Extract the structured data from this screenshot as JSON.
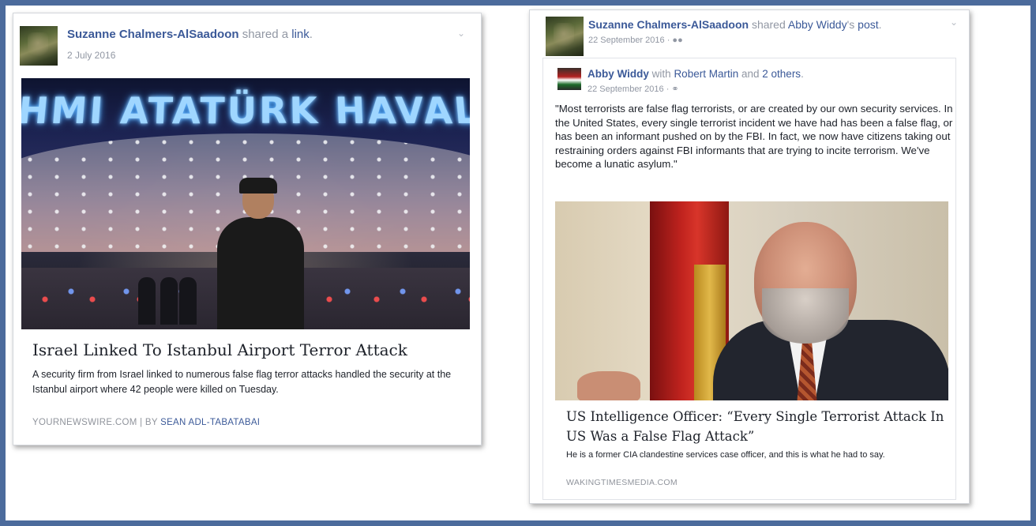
{
  "left_post": {
    "author": "Suzanne Chalmers-AlSaadoon",
    "action": "shared a",
    "object_link": "link",
    "object_suffix": ".",
    "date": "2 July 2016",
    "article": {
      "image_sign": "HMI ATATÜRK HAVALIMAN",
      "headline": "Israel Linked To Istanbul Airport Terror Attack",
      "description": "A security firm from Israel linked to numerous false flag terror attacks handled the security at the Istanbul airport where 42 people were killed on Tuesday.",
      "source": "YOURNEWSWIRE.COM",
      "separator": "|",
      "by_label": "BY",
      "author": "SEAN ADL-TABATABAI"
    }
  },
  "right_post": {
    "author": "Suzanne Chalmers-AlSaadoon",
    "action": "shared",
    "shared_from": "Abby Widdy",
    "shared_from_suffix": "'s",
    "object_link": "post",
    "object_suffix": ".",
    "date": "22 September 2016",
    "privacy_icon": "friends-icon",
    "inner": {
      "author": "Abby Widdy",
      "with_label": "with",
      "tagged": "Robert Martin",
      "and_label": "and",
      "others": "2 others",
      "others_suffix": ".",
      "date": "22 September 2016",
      "privacy_icon": "globe-icon",
      "quote": "\"Most terrorists are false flag terrorists, or are created by our own security services. In the United States, every single terrorist incident we have had has been a false flag, or has been an informant pushed on by the FBI. In fact, we now have citizens taking out restraining orders against FBI informants that are trying to incite terrorism. We've become a lunatic asylum.\""
    },
    "article": {
      "headline": "US Intelligence Officer: “Every Single Terrorist Attack In US Was a False Flag Attack”",
      "description": "He is a former CIA clandestine services case officer, and this is what he had to say.",
      "source": "WAKINGTIMESMEDIA.COM"
    }
  },
  "colors": {
    "frame": "#4c6b9c",
    "name_link": "#3b5998",
    "meta_grey": "#9197a3"
  },
  "icons": {
    "options": "chevron-down-icon"
  }
}
